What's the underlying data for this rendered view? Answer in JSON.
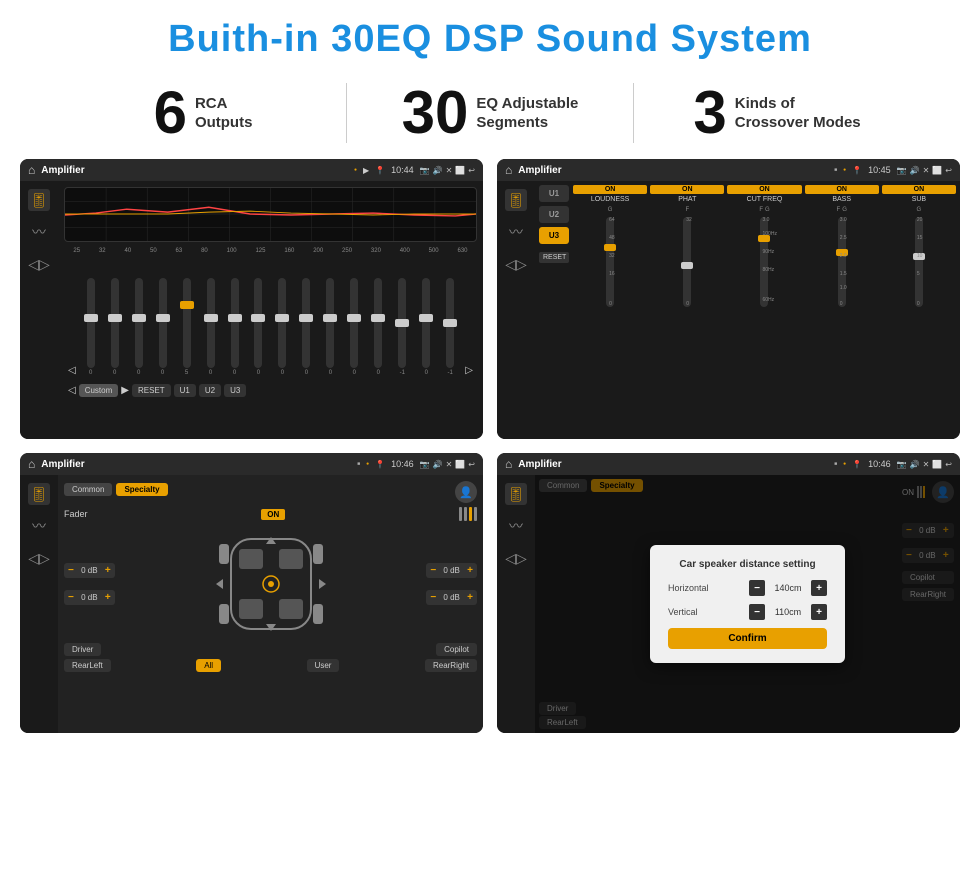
{
  "title": "Buith-in 30EQ DSP Sound System",
  "stats": [
    {
      "number": "6",
      "desc_line1": "RCA",
      "desc_line2": "Outputs"
    },
    {
      "number": "30",
      "desc_line1": "EQ Adjustable",
      "desc_line2": "Segments"
    },
    {
      "number": "3",
      "desc_line1": "Kinds of",
      "desc_line2": "Crossover Modes"
    }
  ],
  "screens": [
    {
      "id": "eq-screen",
      "topbar": {
        "title": "Amplifier",
        "time": "10:44"
      },
      "type": "eq"
    },
    {
      "id": "crossover-screen",
      "topbar": {
        "title": "Amplifier",
        "time": "10:45"
      },
      "type": "crossover"
    },
    {
      "id": "fader-screen",
      "topbar": {
        "title": "Amplifier",
        "time": "10:46"
      },
      "type": "fader"
    },
    {
      "id": "dialog-screen",
      "topbar": {
        "title": "Amplifier",
        "time": "10:46"
      },
      "type": "dialog"
    }
  ],
  "eq": {
    "frequencies": [
      "25",
      "32",
      "40",
      "50",
      "63",
      "80",
      "100",
      "125",
      "160",
      "200",
      "250",
      "320",
      "400",
      "500",
      "630"
    ],
    "values": [
      "0",
      "0",
      "0",
      "0",
      "5",
      "0",
      "0",
      "0",
      "0",
      "0",
      "0",
      "0",
      "0",
      "-1",
      "0",
      "-1"
    ],
    "presets": [
      "Custom",
      "RESET",
      "U1",
      "U2",
      "U3"
    ]
  },
  "crossover": {
    "presets": [
      "U1",
      "U2",
      "U3"
    ],
    "cols": [
      "LOUDNESS",
      "PHAT",
      "CUT FREQ",
      "BASS",
      "SUB"
    ]
  },
  "fader": {
    "tabs": [
      "Common",
      "Specialty"
    ],
    "fader_label": "Fader",
    "on_label": "ON",
    "vol_values": [
      "0 dB",
      "0 dB",
      "0 dB",
      "0 dB"
    ],
    "buttons": [
      "Driver",
      "RearLeft",
      "All",
      "User",
      "RearRight",
      "Copilot"
    ]
  },
  "dialog": {
    "title": "Car speaker distance setting",
    "fields": [
      {
        "label": "Horizontal",
        "value": "140cm"
      },
      {
        "label": "Vertical",
        "value": "110cm"
      }
    ],
    "confirm_label": "Confirm"
  }
}
